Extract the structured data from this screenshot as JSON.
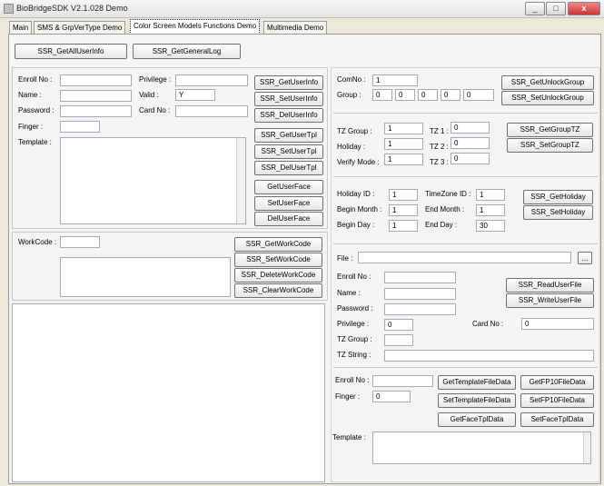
{
  "window": {
    "title": "BioBridgeSDK V2.1.028 Demo"
  },
  "tabs": [
    "Main",
    "SMS & GrpVerType Demo",
    "Color Screen Models Functions Demo",
    "Multimedia Demo"
  ],
  "top_buttons": {
    "get_all_user_info": "SSR_GetAllUserInfo",
    "get_general_log": "SSR_GetGeneralLog"
  },
  "user": {
    "enroll_no_label": "Enroll No :",
    "privilege_label": "Privilege :",
    "name_label": "Name :",
    "valid_label": "Valid :",
    "valid_value": "Y",
    "password_label": "Password :",
    "card_no_label": "Card No :",
    "finger_label": "Finger :",
    "template_label": "Template :",
    "buttons": [
      "SSR_GetUserInfo",
      "SSR_SetUserInfo",
      "SSR_DelUserInfo",
      "SSR_GetUserTpl",
      "SSR_SetUserTpl",
      "SSR_DelUserTpl",
      "GetUserFace",
      "SetUserFace",
      "DelUserFace"
    ]
  },
  "workcode": {
    "label": "WorkCode :",
    "buttons": [
      "SSR_GetWorkCode",
      "SSR_SetWorkCode",
      "SSR_DeleteWorkCode",
      "SSR_ClearWorkCode"
    ]
  },
  "unlock": {
    "comno_label": "ComNo :",
    "comno_value": "1",
    "group_label": "Group :",
    "group_values": [
      "0",
      "0",
      "0",
      "0",
      "0"
    ],
    "buttons": [
      "SSR_GetUnlockGroup",
      "SSR_SetUnlockGroup"
    ]
  },
  "tzgroup": {
    "tz_group_label": "TZ Group :",
    "tz_group_value": "1",
    "holiday_label": "Holiday :",
    "holiday_value": "1",
    "verify_mode_label": "Verify Mode :",
    "verify_mode_value": "1",
    "tz1_label": "TZ 1 :",
    "tz1_value": "0",
    "tz2_label": "TZ 2 :",
    "tz2_value": "0",
    "tz3_label": "TZ 3 :",
    "tz3_value": "0",
    "buttons": [
      "SSR_GetGroupTZ",
      "SSR_SetGroupTZ"
    ]
  },
  "holiday": {
    "holiday_id_label": "Holiday ID :",
    "holiday_id_value": "1",
    "timezone_id_label": "TimeZone ID :",
    "timezone_id_value": "1",
    "begin_month_label": "Begin Month :",
    "begin_month_value": "1",
    "end_month_label": "End Month :",
    "end_month_value": "1",
    "begin_day_label": "Begin Day :",
    "begin_day_value": "1",
    "end_day_label": "End Day :",
    "end_day_value": "30",
    "buttons": [
      "SSR_GetHoliday",
      "SSR_SetHoliday"
    ]
  },
  "file_user": {
    "file_label": "File :",
    "browse_label": "...",
    "enroll_no_label": "Enroll No :",
    "name_label": "Name :",
    "password_label": "Password :",
    "privilege_label": "Privilege :",
    "privilege_value": "0",
    "card_no_label": "Card No :",
    "card_no_value": "0",
    "tz_group_label": "TZ Group :",
    "tz_string_label": "TZ String :",
    "buttons": [
      "SSR_ReadUserFile",
      "SSR_WriteUserFile"
    ]
  },
  "template_file": {
    "enroll_no_label": "Enroll No :",
    "finger_label": "Finger :",
    "finger_value": "0",
    "template_label": "Template :",
    "buttons": [
      "GetTemplateFileData",
      "GetFP10FileData",
      "SetTemplateFileData",
      "SetFP10FileData",
      "GetFaceTplData",
      "SetFaceTplData"
    ]
  }
}
